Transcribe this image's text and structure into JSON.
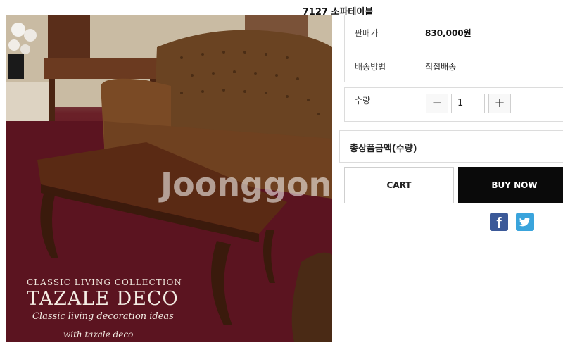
{
  "product": {
    "title": "7127 소파테이블",
    "image_alt": "소파테이블 product photo",
    "watermark": "Joonggon",
    "brand_line1": "CLASSIC LIVING COLLECTION",
    "brand_line2": "TAZALE DECO",
    "brand_line3": "Classic living decoration ideas",
    "brand_line4": "with tazale deco"
  },
  "info": {
    "price_label": "판매가",
    "price_value": "830,000원",
    "shipping_label": "배송방법",
    "shipping_value": "직접배송"
  },
  "quantity": {
    "label": "수량",
    "minus": "−",
    "plus": "+",
    "value": "1"
  },
  "total": {
    "label": "총상품금액(수량)"
  },
  "actions": {
    "cart_label": "CART",
    "buy_label": "BUY NOW"
  },
  "social": {
    "facebook_glyph": "f",
    "twitter_glyph": "🐦",
    "facebook_color": "#3b5998",
    "twitter_color": "#3aa4dc"
  },
  "colors": {
    "buy_button": "#0a0a0a",
    "border": "#dcdcdc"
  }
}
